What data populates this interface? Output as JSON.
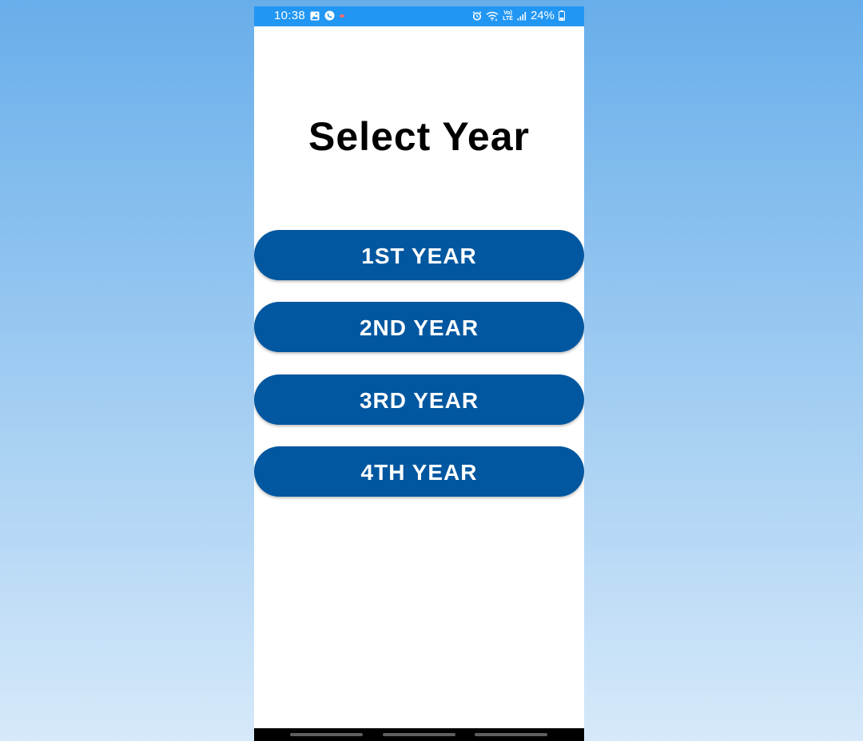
{
  "status_bar": {
    "time": "10:38",
    "battery": "24%",
    "network_label_top": "Vo)",
    "network_label_bottom": "LTE",
    "background_color": "#2196f3",
    "icons": [
      "gallery-icon",
      "whatsapp-icon",
      "alarm-icon",
      "wifi-icon",
      "signal-icon",
      "battery-icon"
    ]
  },
  "page": {
    "title": "Select Year"
  },
  "buttons": [
    {
      "label": "1ST YEAR"
    },
    {
      "label": "2ND YEAR"
    },
    {
      "label": "3RD YEAR"
    },
    {
      "label": "4TH YEAR"
    }
  ],
  "colors": {
    "button_background": "#0157a0",
    "button_text": "#ffffff",
    "title_text": "#000000",
    "background_top": "#68aeea",
    "background_bottom": "#d6e9fa"
  }
}
